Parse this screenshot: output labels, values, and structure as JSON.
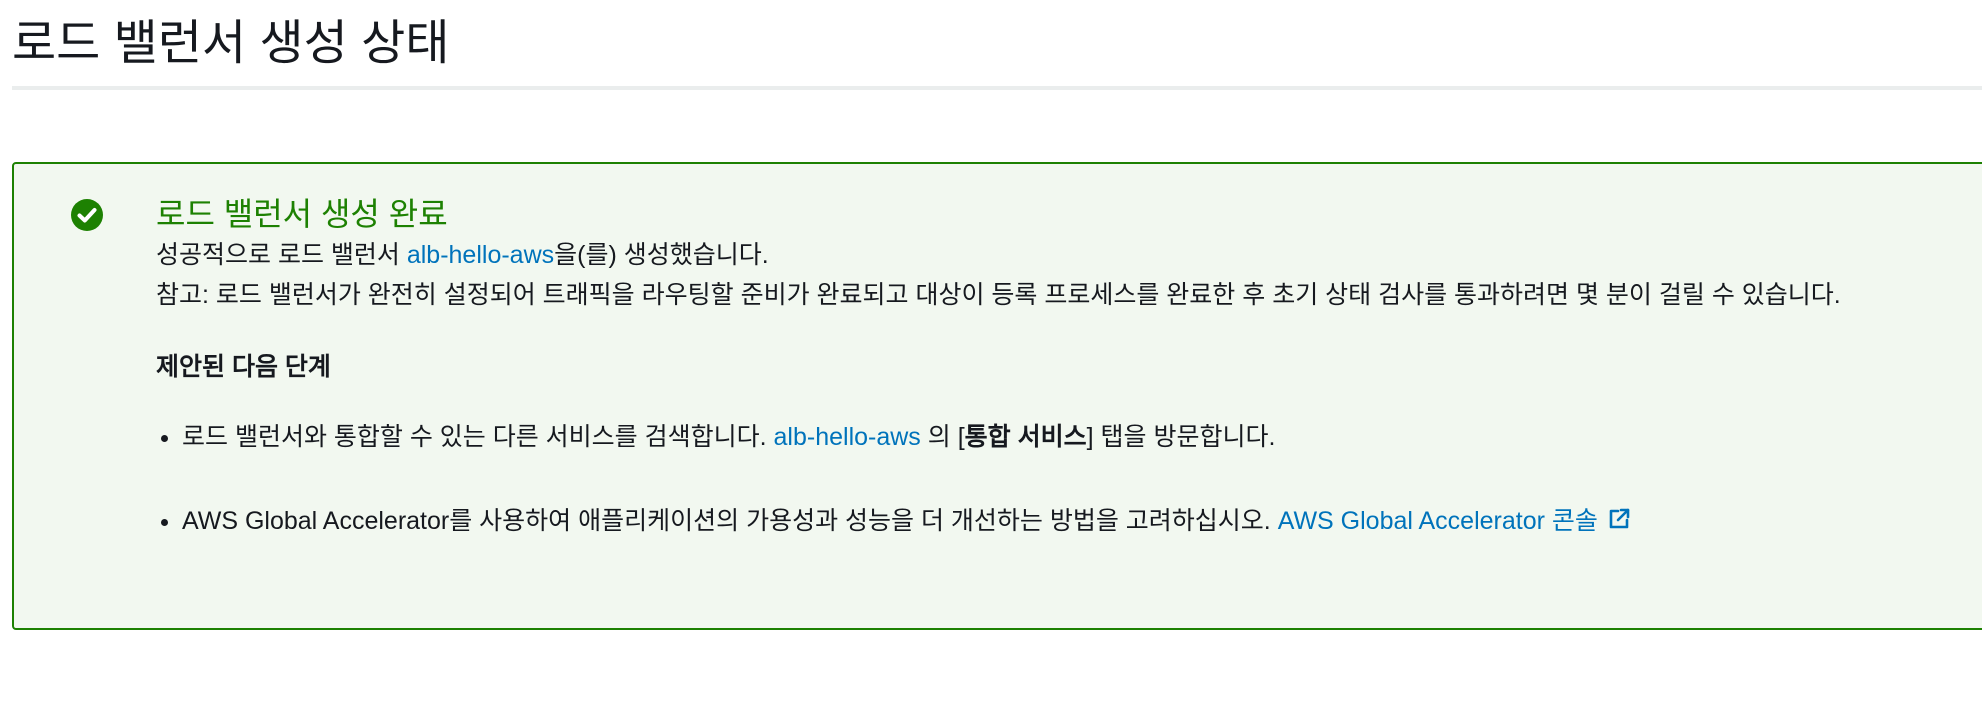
{
  "page": {
    "title": "로드 밸런서 생성 상태"
  },
  "flash": {
    "status": "success",
    "icon": "check-circle-icon",
    "title": "로드 밸런서 생성 완료",
    "message": {
      "before": "성공적으로 로드 밸런서 ",
      "lb_name": "alb-hello-aws",
      "after": "을(를) 생성했습니다."
    },
    "note": "참고: 로드 밸런서가 완전히 설정되어 트래픽을 라우팅할 준비가 완료되고 대상이 등록 프로세스를 완료한 후 초기 상태 검사를 통과하려면 몇 분이 걸릴 수 있습니다.",
    "steps_heading": "제안된 다음 단계",
    "steps": [
      {
        "text_before": "로드 밸런서와 통합할 수 있는 다른 서비스를 검색합니다. ",
        "link": "alb-hello-aws",
        "text_middle": " 의 [",
        "bold": "통합 서비스",
        "text_after": "] 탭을 방문합니다."
      },
      {
        "text_before": "AWS Global Accelerator를 사용하여 애플리케이션의 가용성과 성능을 더 개선하는 방법을 고려하십시오. ",
        "link": "AWS Global Accelerator 콘솔",
        "link_icon": "external-link-icon"
      }
    ]
  },
  "colors": {
    "success": "#1d8102",
    "success_bg": "#f2f8f0",
    "link": "#0073bb",
    "text": "#16191f",
    "divider": "#eaeded"
  }
}
